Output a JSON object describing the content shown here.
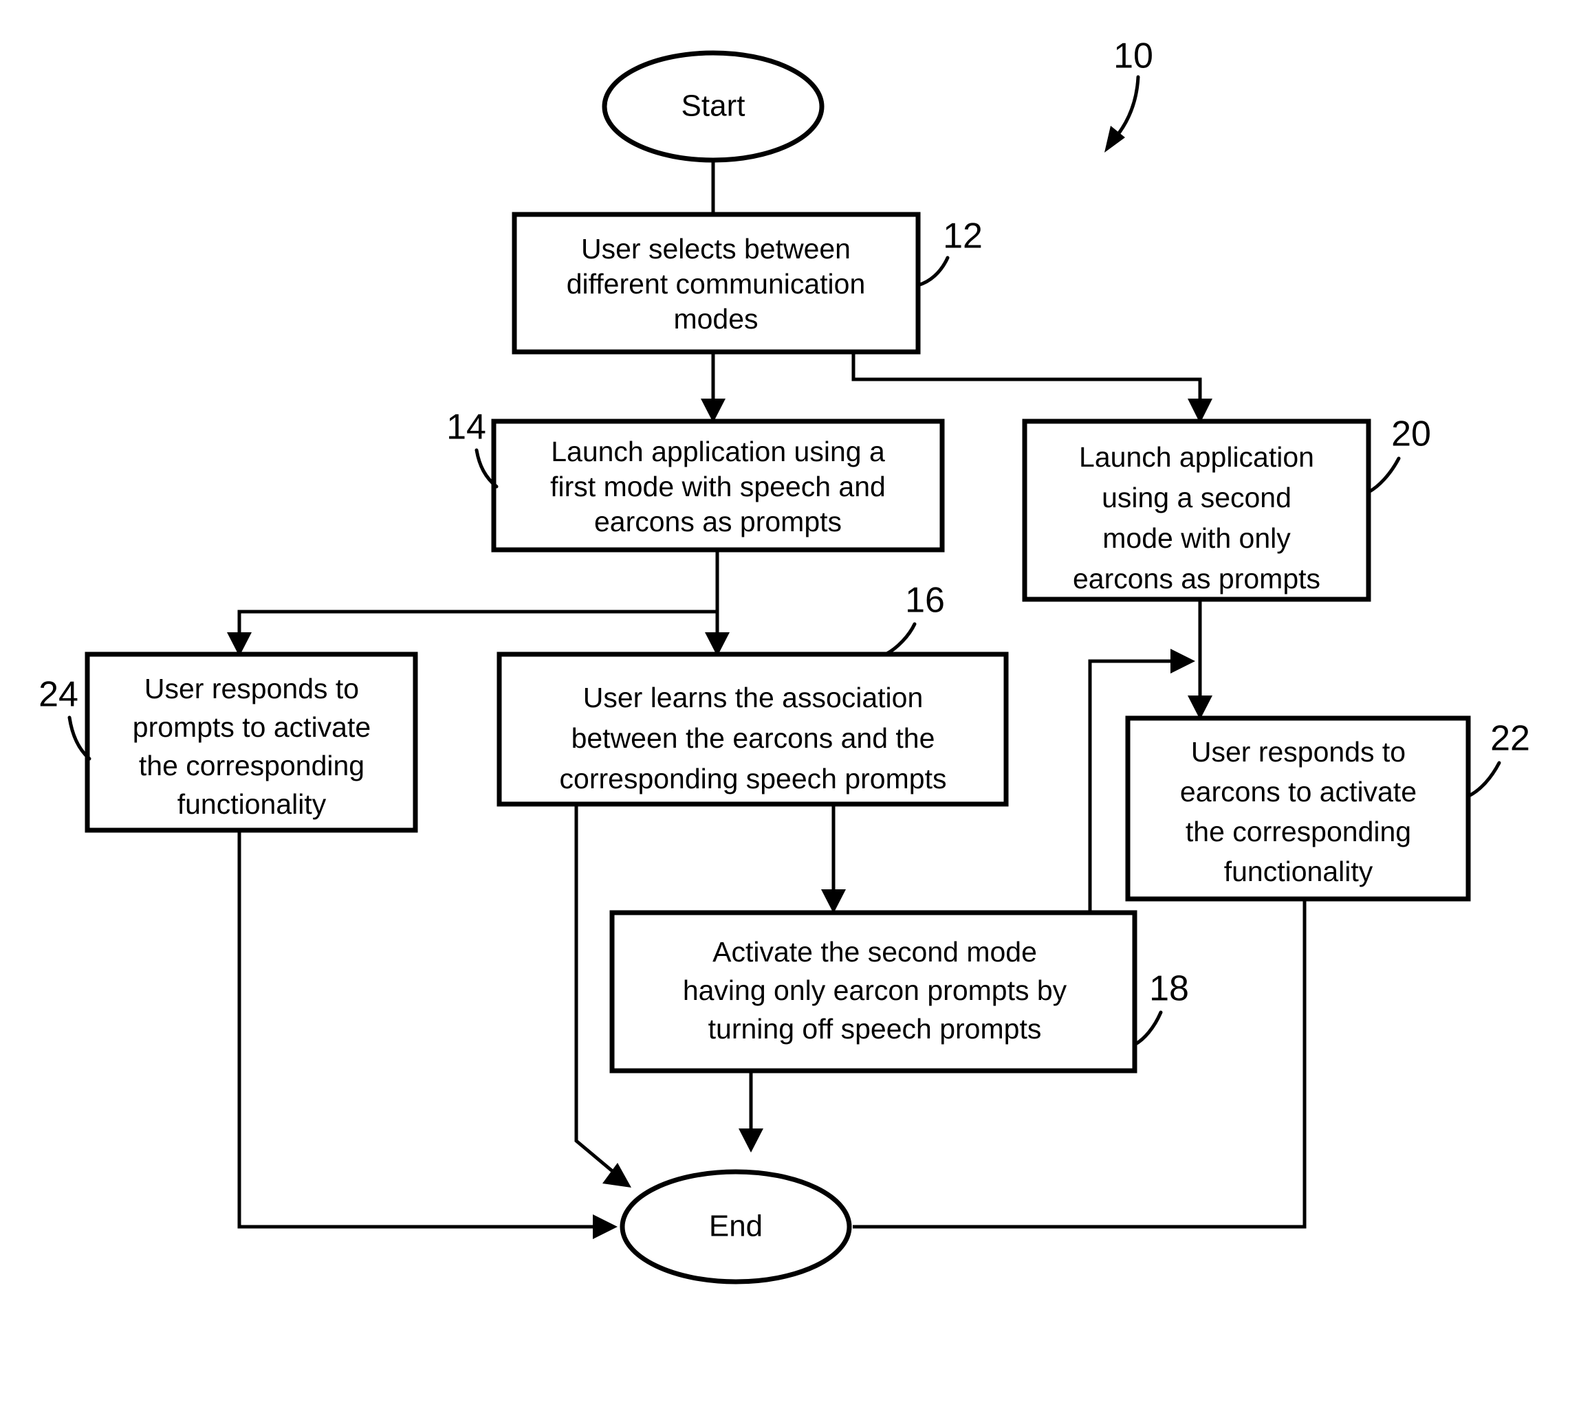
{
  "figure": {
    "reference_numeral": "10",
    "type": "flowchart"
  },
  "nodes": {
    "start": {
      "label": "Start",
      "shape": "ellipse"
    },
    "end": {
      "label": "End",
      "shape": "ellipse"
    },
    "step12": {
      "ref": "12",
      "lines": [
        "User selects between",
        "different communication",
        "modes"
      ]
    },
    "step14": {
      "ref": "14",
      "lines": [
        "Launch application using a",
        "first mode with speech and",
        "earcons as prompts"
      ]
    },
    "step20": {
      "ref": "20",
      "lines": [
        "Launch application",
        "using a second",
        "mode with only",
        "earcons as prompts"
      ]
    },
    "step24": {
      "ref": "24",
      "lines": [
        "User responds to",
        "prompts to activate",
        "the corresponding",
        "functionality"
      ]
    },
    "step16": {
      "ref": "16",
      "lines": [
        "User learns the association",
        "between the earcons and the",
        "corresponding speech prompts"
      ]
    },
    "step22": {
      "ref": "22",
      "lines": [
        "User responds to",
        "earcons to activate",
        "the corresponding",
        "functionality"
      ]
    },
    "step18": {
      "ref": "18",
      "lines": [
        "Activate the second mode",
        "having only earcon prompts by",
        "turning off speech prompts"
      ]
    }
  },
  "colors": {
    "stroke": "#000000",
    "fill": "#ffffff",
    "text": "#000000"
  }
}
